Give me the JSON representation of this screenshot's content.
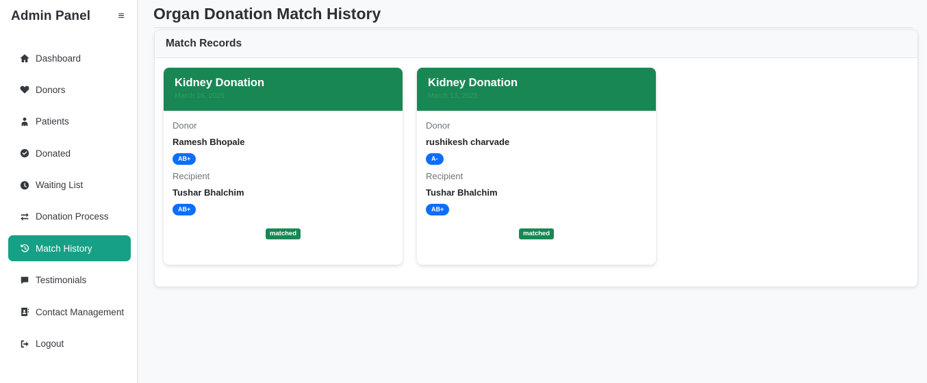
{
  "sidebar": {
    "brand": "Admin Panel",
    "toggle_icon": "hamburger-icon",
    "items": [
      {
        "label": "Dashboard",
        "icon": "home-icon",
        "active": false
      },
      {
        "label": "Donors",
        "icon": "heart-icon",
        "active": false
      },
      {
        "label": "Patients",
        "icon": "user-injured-icon",
        "active": false
      },
      {
        "label": "Donated",
        "icon": "check-circle-icon",
        "active": false
      },
      {
        "label": "Waiting List",
        "icon": "clock-icon",
        "active": false
      },
      {
        "label": "Donation Process",
        "icon": "exchange-icon",
        "active": false
      },
      {
        "label": "Match History",
        "icon": "history-icon",
        "active": true
      },
      {
        "label": "Testimonials",
        "icon": "comment-icon",
        "active": false
      },
      {
        "label": "Contact Management",
        "icon": "address-book-icon",
        "active": false
      },
      {
        "label": "Logout",
        "icon": "sign-out-icon",
        "active": false
      }
    ]
  },
  "main": {
    "title": "Organ Donation Match History",
    "records_header": "Match Records",
    "matches": [
      {
        "organ": "Kidney Donation",
        "date": "March 16, 2025",
        "donor_label": "Donor",
        "donor_name": "Ramesh Bhopale",
        "donor_blood": "AB+",
        "recipient_label": "Recipient",
        "recipient_name": "Tushar Bhalchim",
        "recipient_blood": "AB+",
        "status": "matched"
      },
      {
        "organ": "Kidney Donation",
        "date": "March 13, 2025",
        "donor_label": "Donor",
        "donor_name": "rushikesh charvade",
        "donor_blood": "A-",
        "recipient_label": "Recipient",
        "recipient_name": "Tushar Bhalchim",
        "recipient_blood": "AB+",
        "status": "matched"
      }
    ]
  },
  "colors": {
    "accent": "#16a085",
    "card_header": "#198754",
    "blood_badge": "#0d6efd",
    "status_badge": "#198754"
  }
}
